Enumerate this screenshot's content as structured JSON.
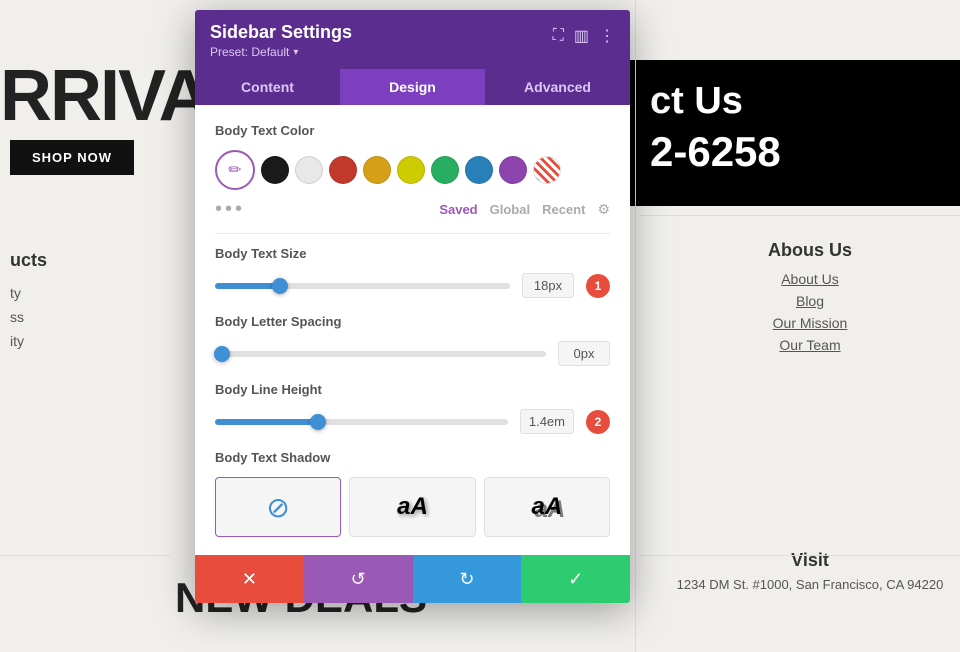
{
  "background": {
    "arrivals_text": "RRIVALS A",
    "shop_now": "SHOP NOW",
    "products_label": "ucts",
    "product_links": [
      "ty",
      "ss",
      "ity"
    ],
    "new_deals": "NEW DEALS",
    "contact_title": "ct Us",
    "contact_phone": "2-6258",
    "about_us_title": "Abous Us",
    "about_us_links": [
      "About Us",
      "Blog",
      "Our Mission",
      "Our Team"
    ],
    "visit_title": "Visit",
    "visit_address": "1234 DM St. #1000, San Francisco, CA 94220"
  },
  "panel": {
    "title": "Sidebar Settings",
    "preset_label": "Preset: Default",
    "tabs": [
      {
        "id": "content",
        "label": "Content"
      },
      {
        "id": "design",
        "label": "Design"
      },
      {
        "id": "advanced",
        "label": "Advanced"
      }
    ],
    "active_tab": "design",
    "body_text_color_label": "Body Text Color",
    "colors": [
      {
        "hex": "#1a1a1a"
      },
      {
        "hex": "#e8e8e8"
      },
      {
        "hex": "#c0392b"
      },
      {
        "hex": "#d4a017"
      },
      {
        "hex": "#cccc00"
      },
      {
        "hex": "#27ae60"
      },
      {
        "hex": "#2980b9"
      },
      {
        "hex": "#8e44ad"
      },
      {
        "hex": "#e74c3c",
        "strikethrough": true
      }
    ],
    "color_tabs": [
      {
        "id": "saved",
        "label": "Saved",
        "active": true
      },
      {
        "id": "global",
        "label": "Global",
        "active": false
      },
      {
        "id": "recent",
        "label": "Recent",
        "active": false
      }
    ],
    "body_text_size_label": "Body Text Size",
    "body_text_size_value": "18px",
    "body_text_size_percent": 22,
    "badge1": "1",
    "body_letter_spacing_label": "Body Letter Spacing",
    "body_letter_spacing_value": "0px",
    "body_letter_spacing_percent": 2,
    "body_line_height_label": "Body Line Height",
    "body_line_height_value": "1.4em",
    "body_line_height_percent": 35,
    "badge2": "2",
    "body_text_shadow_label": "Body Text Shadow",
    "shadow_options": [
      {
        "id": "none",
        "symbol": "⊘",
        "selected": true
      },
      {
        "id": "soft",
        "symbol": "aA"
      },
      {
        "id": "hard",
        "symbol": "aA"
      }
    ],
    "footer": {
      "cancel_label": "✕",
      "reset_label": "↺",
      "redo_label": "↻",
      "save_label": "✓"
    }
  }
}
